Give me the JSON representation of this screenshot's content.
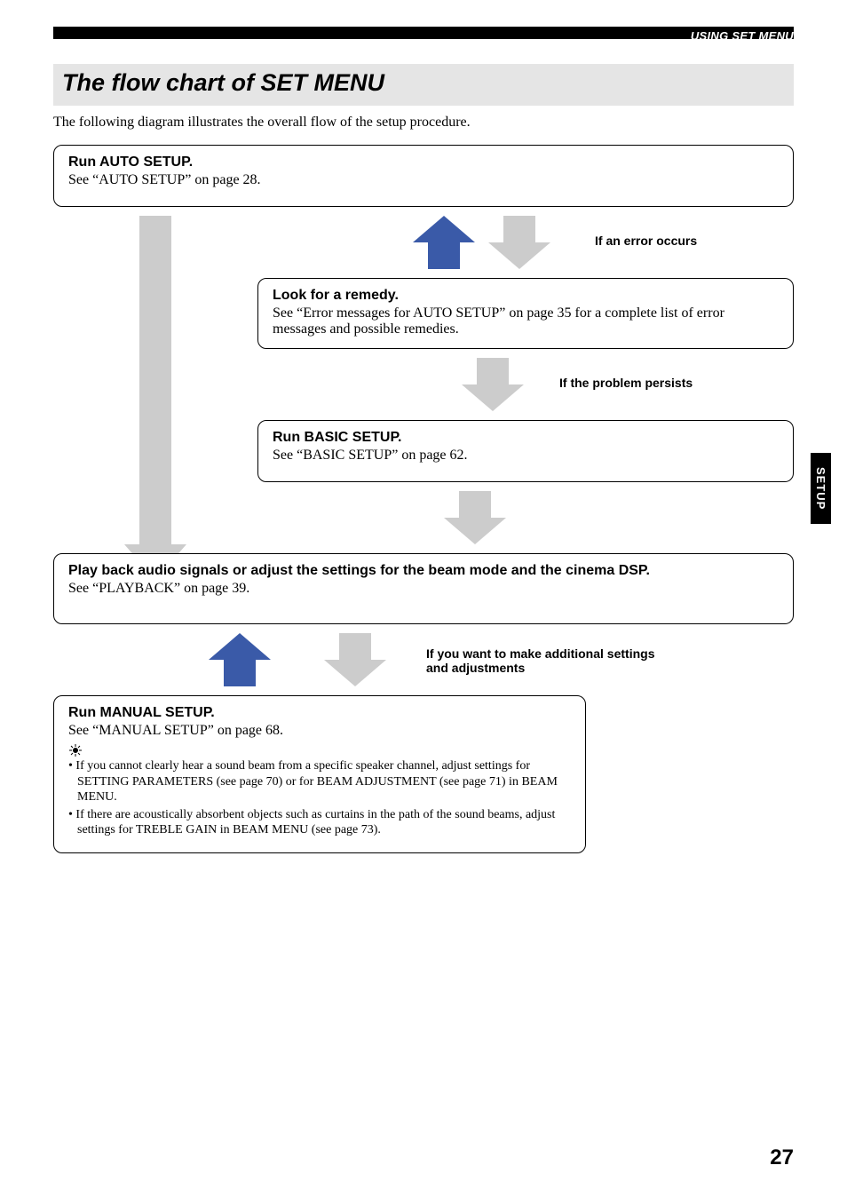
{
  "header": {
    "section_label": "USING SET MENU"
  },
  "title": "The flow chart of SET MENU",
  "intro": "The following diagram illustrates the overall flow of the setup procedure.",
  "boxes": {
    "auto": {
      "title": "Run AUTO SETUP.",
      "text": "See “AUTO SETUP” on page 28."
    },
    "remedy": {
      "title": "Look for a remedy.",
      "text": "See “Error messages for AUTO SETUP” on page 35 for a complete list of error messages and possible remedies."
    },
    "basic": {
      "title": "Run BASIC SETUP.",
      "text": "See “BASIC SETUP” on page 62."
    },
    "playback": {
      "title": "Play back audio signals or adjust the settings for the beam mode and the cinema DSP.",
      "text": "See “PLAYBACK” on page 39."
    },
    "manual": {
      "title": "Run MANUAL SETUP.",
      "text": "See “MANUAL SETUP” on page 68.",
      "tips": [
        "• If you cannot clearly hear a sound beam from a specific speaker channel, adjust settings for SETTING PARAMETERS (see page 70) or for BEAM ADJUSTMENT (see page 71) in BEAM MENU.",
        "• If there are acoustically absorbent objects such as curtains in the path of the sound beams, adjust settings for TREBLE GAIN in BEAM MENU (see page 73)."
      ]
    }
  },
  "labels": {
    "error": "If an error occurs",
    "persists": "If the problem persists",
    "additional_l1": "If you want to make additional settings",
    "additional_l2": "and adjustments"
  },
  "side_tab": "SETUP",
  "page_number": "27"
}
